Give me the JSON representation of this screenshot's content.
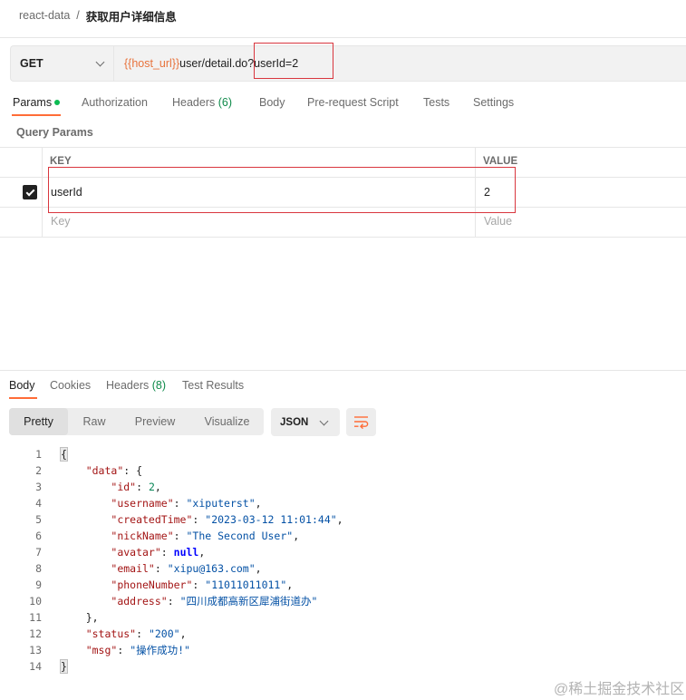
{
  "breadcrumb": {
    "parent": "react-data",
    "separator": "/",
    "current": "获取用户详细信息"
  },
  "request": {
    "method": "GET",
    "url_variable": "{{host_url}}",
    "url_path": "user/detail.do",
    "url_query": "?userId=2"
  },
  "request_tabs": [
    {
      "label": "Params",
      "active": true
    },
    {
      "label": "Authorization"
    },
    {
      "label": "Headers",
      "count": "(6)"
    },
    {
      "label": "Body"
    },
    {
      "label": "Pre-request Script"
    },
    {
      "label": "Tests"
    },
    {
      "label": "Settings"
    }
  ],
  "query_params": {
    "title": "Query Params",
    "columns": {
      "key": "KEY",
      "value": "VALUE"
    },
    "rows": [
      {
        "key": "userId",
        "value": "2",
        "enabled": true
      }
    ],
    "placeholder": {
      "key": "Key",
      "value": "Value"
    }
  },
  "response_tabs": [
    {
      "label": "Body",
      "active": true
    },
    {
      "label": "Cookies"
    },
    {
      "label": "Headers",
      "count": "(8)"
    },
    {
      "label": "Test Results"
    }
  ],
  "view_modes": [
    {
      "label": "Pretty",
      "active": true
    },
    {
      "label": "Raw"
    },
    {
      "label": "Preview"
    },
    {
      "label": "Visualize"
    }
  ],
  "format": "JSON",
  "icons": {
    "method_dropdown": "chevron-down-icon",
    "format_dropdown": "chevron-down-icon",
    "wrap": "wrap-lines-icon",
    "checkbox": "checkmark-icon"
  },
  "colors": {
    "accent": "#ff6c37",
    "url_variable": "#e8733c",
    "dot": "#0cbb52",
    "count": "#0f8a4a",
    "highlight_box": "#d9363e"
  },
  "response_lines": [
    {
      "n": "1",
      "tokens": [
        {
          "t": "p",
          "v": "{"
        }
      ]
    },
    {
      "n": "2",
      "tokens": [
        {
          "t": "p",
          "v": "    "
        },
        {
          "t": "k",
          "v": "\"data\""
        },
        {
          "t": "p",
          "v": ": {"
        }
      ]
    },
    {
      "n": "3",
      "tokens": [
        {
          "t": "p",
          "v": "        "
        },
        {
          "t": "k",
          "v": "\"id\""
        },
        {
          "t": "p",
          "v": ": "
        },
        {
          "t": "n",
          "v": "2"
        },
        {
          "t": "p",
          "v": ","
        }
      ]
    },
    {
      "n": "4",
      "tokens": [
        {
          "t": "p",
          "v": "        "
        },
        {
          "t": "k",
          "v": "\"username\""
        },
        {
          "t": "p",
          "v": ": "
        },
        {
          "t": "s",
          "v": "\"xiputerst\""
        },
        {
          "t": "p",
          "v": ","
        }
      ]
    },
    {
      "n": "5",
      "tokens": [
        {
          "t": "p",
          "v": "        "
        },
        {
          "t": "k",
          "v": "\"createdTime\""
        },
        {
          "t": "p",
          "v": ": "
        },
        {
          "t": "s",
          "v": "\"2023-03-12 11:01:44\""
        },
        {
          "t": "p",
          "v": ","
        }
      ]
    },
    {
      "n": "6",
      "tokens": [
        {
          "t": "p",
          "v": "        "
        },
        {
          "t": "k",
          "v": "\"nickName\""
        },
        {
          "t": "p",
          "v": ": "
        },
        {
          "t": "s",
          "v": "\"The Second User\""
        },
        {
          "t": "p",
          "v": ","
        }
      ]
    },
    {
      "n": "7",
      "tokens": [
        {
          "t": "p",
          "v": "        "
        },
        {
          "t": "k",
          "v": "\"avatar\""
        },
        {
          "t": "p",
          "v": ": "
        },
        {
          "t": "kw",
          "v": "null"
        },
        {
          "t": "p",
          "v": ","
        }
      ]
    },
    {
      "n": "8",
      "tokens": [
        {
          "t": "p",
          "v": "        "
        },
        {
          "t": "k",
          "v": "\"email\""
        },
        {
          "t": "p",
          "v": ": "
        },
        {
          "t": "s",
          "v": "\"xipu@163.com\""
        },
        {
          "t": "p",
          "v": ","
        }
      ]
    },
    {
      "n": "9",
      "tokens": [
        {
          "t": "p",
          "v": "        "
        },
        {
          "t": "k",
          "v": "\"phoneNumber\""
        },
        {
          "t": "p",
          "v": ": "
        },
        {
          "t": "s",
          "v": "\"11011011011\""
        },
        {
          "t": "p",
          "v": ","
        }
      ]
    },
    {
      "n": "10",
      "tokens": [
        {
          "t": "p",
          "v": "        "
        },
        {
          "t": "k",
          "v": "\"address\""
        },
        {
          "t": "p",
          "v": ": "
        },
        {
          "t": "s",
          "v": "\"四川成都高新区犀浦街道办\""
        }
      ]
    },
    {
      "n": "11",
      "tokens": [
        {
          "t": "p",
          "v": "    },"
        }
      ]
    },
    {
      "n": "12",
      "tokens": [
        {
          "t": "p",
          "v": "    "
        },
        {
          "t": "k",
          "v": "\"status\""
        },
        {
          "t": "p",
          "v": ": "
        },
        {
          "t": "s",
          "v": "\"200\""
        },
        {
          "t": "p",
          "v": ","
        }
      ]
    },
    {
      "n": "13",
      "tokens": [
        {
          "t": "p",
          "v": "    "
        },
        {
          "t": "k",
          "v": "\"msg\""
        },
        {
          "t": "p",
          "v": ": "
        },
        {
          "t": "s",
          "v": "\"操作成功!\""
        }
      ]
    },
    {
      "n": "14",
      "tokens": [
        {
          "t": "p",
          "v": "}"
        }
      ]
    }
  ],
  "watermark": "@稀土掘金技术社区"
}
